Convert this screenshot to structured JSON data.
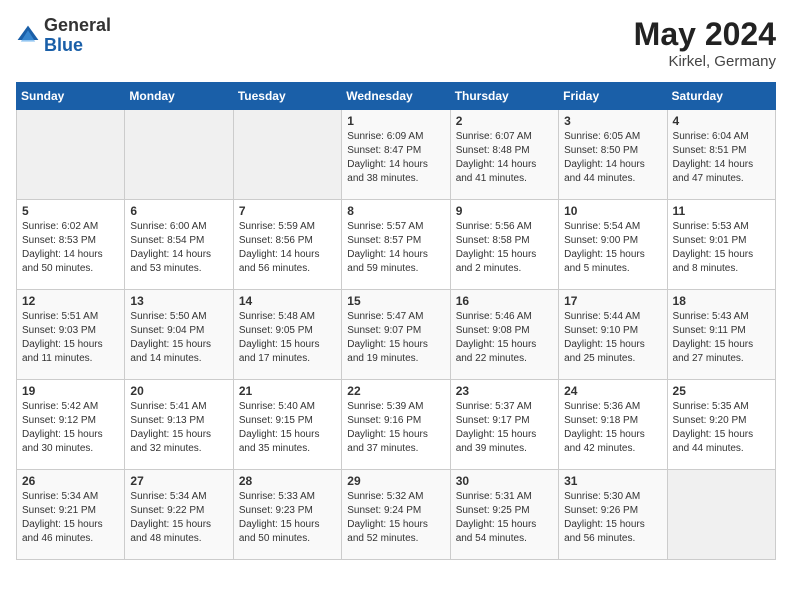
{
  "header": {
    "logo_general": "General",
    "logo_blue": "Blue",
    "month_year": "May 2024",
    "location": "Kirkel, Germany"
  },
  "weekdays": [
    "Sunday",
    "Monday",
    "Tuesday",
    "Wednesday",
    "Thursday",
    "Friday",
    "Saturday"
  ],
  "weeks": [
    [
      {
        "day": "",
        "info": ""
      },
      {
        "day": "",
        "info": ""
      },
      {
        "day": "",
        "info": ""
      },
      {
        "day": "1",
        "info": "Sunrise: 6:09 AM\nSunset: 8:47 PM\nDaylight: 14 hours\nand 38 minutes."
      },
      {
        "day": "2",
        "info": "Sunrise: 6:07 AM\nSunset: 8:48 PM\nDaylight: 14 hours\nand 41 minutes."
      },
      {
        "day": "3",
        "info": "Sunrise: 6:05 AM\nSunset: 8:50 PM\nDaylight: 14 hours\nand 44 minutes."
      },
      {
        "day": "4",
        "info": "Sunrise: 6:04 AM\nSunset: 8:51 PM\nDaylight: 14 hours\nand 47 minutes."
      }
    ],
    [
      {
        "day": "5",
        "info": "Sunrise: 6:02 AM\nSunset: 8:53 PM\nDaylight: 14 hours\nand 50 minutes."
      },
      {
        "day": "6",
        "info": "Sunrise: 6:00 AM\nSunset: 8:54 PM\nDaylight: 14 hours\nand 53 minutes."
      },
      {
        "day": "7",
        "info": "Sunrise: 5:59 AM\nSunset: 8:56 PM\nDaylight: 14 hours\nand 56 minutes."
      },
      {
        "day": "8",
        "info": "Sunrise: 5:57 AM\nSunset: 8:57 PM\nDaylight: 14 hours\nand 59 minutes."
      },
      {
        "day": "9",
        "info": "Sunrise: 5:56 AM\nSunset: 8:58 PM\nDaylight: 15 hours\nand 2 minutes."
      },
      {
        "day": "10",
        "info": "Sunrise: 5:54 AM\nSunset: 9:00 PM\nDaylight: 15 hours\nand 5 minutes."
      },
      {
        "day": "11",
        "info": "Sunrise: 5:53 AM\nSunset: 9:01 PM\nDaylight: 15 hours\nand 8 minutes."
      }
    ],
    [
      {
        "day": "12",
        "info": "Sunrise: 5:51 AM\nSunset: 9:03 PM\nDaylight: 15 hours\nand 11 minutes."
      },
      {
        "day": "13",
        "info": "Sunrise: 5:50 AM\nSunset: 9:04 PM\nDaylight: 15 hours\nand 14 minutes."
      },
      {
        "day": "14",
        "info": "Sunrise: 5:48 AM\nSunset: 9:05 PM\nDaylight: 15 hours\nand 17 minutes."
      },
      {
        "day": "15",
        "info": "Sunrise: 5:47 AM\nSunset: 9:07 PM\nDaylight: 15 hours\nand 19 minutes."
      },
      {
        "day": "16",
        "info": "Sunrise: 5:46 AM\nSunset: 9:08 PM\nDaylight: 15 hours\nand 22 minutes."
      },
      {
        "day": "17",
        "info": "Sunrise: 5:44 AM\nSunset: 9:10 PM\nDaylight: 15 hours\nand 25 minutes."
      },
      {
        "day": "18",
        "info": "Sunrise: 5:43 AM\nSunset: 9:11 PM\nDaylight: 15 hours\nand 27 minutes."
      }
    ],
    [
      {
        "day": "19",
        "info": "Sunrise: 5:42 AM\nSunset: 9:12 PM\nDaylight: 15 hours\nand 30 minutes."
      },
      {
        "day": "20",
        "info": "Sunrise: 5:41 AM\nSunset: 9:13 PM\nDaylight: 15 hours\nand 32 minutes."
      },
      {
        "day": "21",
        "info": "Sunrise: 5:40 AM\nSunset: 9:15 PM\nDaylight: 15 hours\nand 35 minutes."
      },
      {
        "day": "22",
        "info": "Sunrise: 5:39 AM\nSunset: 9:16 PM\nDaylight: 15 hours\nand 37 minutes."
      },
      {
        "day": "23",
        "info": "Sunrise: 5:37 AM\nSunset: 9:17 PM\nDaylight: 15 hours\nand 39 minutes."
      },
      {
        "day": "24",
        "info": "Sunrise: 5:36 AM\nSunset: 9:18 PM\nDaylight: 15 hours\nand 42 minutes."
      },
      {
        "day": "25",
        "info": "Sunrise: 5:35 AM\nSunset: 9:20 PM\nDaylight: 15 hours\nand 44 minutes."
      }
    ],
    [
      {
        "day": "26",
        "info": "Sunrise: 5:34 AM\nSunset: 9:21 PM\nDaylight: 15 hours\nand 46 minutes."
      },
      {
        "day": "27",
        "info": "Sunrise: 5:34 AM\nSunset: 9:22 PM\nDaylight: 15 hours\nand 48 minutes."
      },
      {
        "day": "28",
        "info": "Sunrise: 5:33 AM\nSunset: 9:23 PM\nDaylight: 15 hours\nand 50 minutes."
      },
      {
        "day": "29",
        "info": "Sunrise: 5:32 AM\nSunset: 9:24 PM\nDaylight: 15 hours\nand 52 minutes."
      },
      {
        "day": "30",
        "info": "Sunrise: 5:31 AM\nSunset: 9:25 PM\nDaylight: 15 hours\nand 54 minutes."
      },
      {
        "day": "31",
        "info": "Sunrise: 5:30 AM\nSunset: 9:26 PM\nDaylight: 15 hours\nand 56 minutes."
      },
      {
        "day": "",
        "info": ""
      }
    ]
  ]
}
